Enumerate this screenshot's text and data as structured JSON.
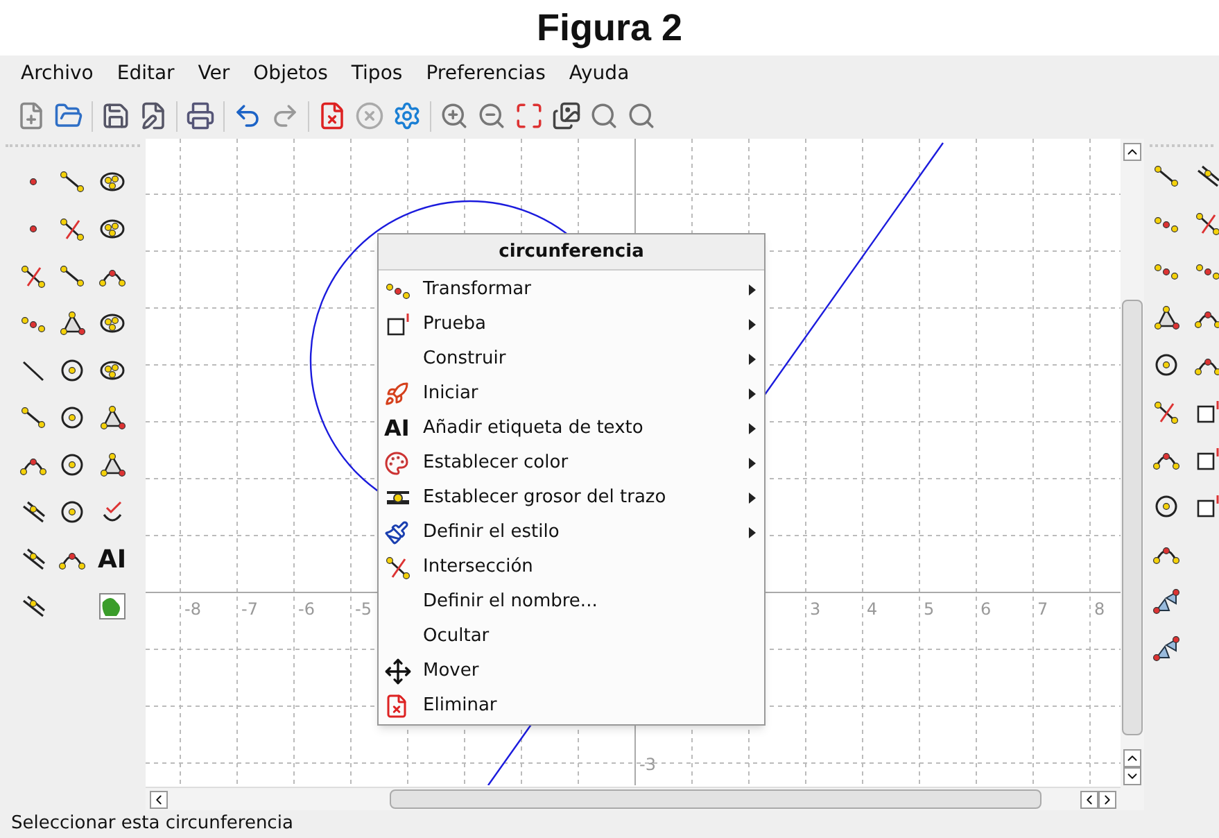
{
  "caption": "Figura 2",
  "menu_bar": [
    "Archivo",
    "Editar",
    "Ver",
    "Objetos",
    "Tipos",
    "Preferencias",
    "Ayuda"
  ],
  "text_tool_glyph": "AI",
  "x_axis_labels": [
    "-8",
    "-7",
    "-6",
    "-5",
    "3",
    "4",
    "5",
    "6",
    "7",
    "8"
  ],
  "y_axis_labels": [
    "-3"
  ],
  "context_menu": {
    "title": "circunferencia",
    "items": [
      {
        "label": "Transformar",
        "submenu": true
      },
      {
        "label": "Prueba",
        "submenu": true
      },
      {
        "label": "Construir",
        "submenu": true
      },
      {
        "label": "Iniciar",
        "submenu": true
      },
      {
        "label": "Añadir etiqueta de texto",
        "submenu": true,
        "glyph": "AI"
      },
      {
        "label": "Establecer color",
        "submenu": true
      },
      {
        "label": "Establecer grosor del trazo",
        "submenu": true
      },
      {
        "label": "Definir el estilo",
        "submenu": true
      },
      {
        "label": "Intersección",
        "submenu": false
      },
      {
        "label": "Definir el nombre...",
        "submenu": false
      },
      {
        "label": "Ocultar",
        "submenu": false
      },
      {
        "label": "Mover",
        "submenu": false
      },
      {
        "label": "Eliminar",
        "submenu": false
      }
    ]
  },
  "status_bar": "Seleccionar esta circunferencia"
}
